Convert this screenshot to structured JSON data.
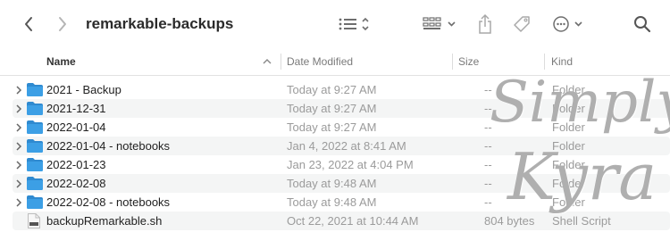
{
  "window": {
    "title": "remarkable-backups",
    "toolbar_icons": [
      "chevron-left-icon",
      "chevron-right-icon",
      "list-view-icon",
      "group-icon",
      "share-icon",
      "tag-icon",
      "more-icon",
      "search-icon"
    ]
  },
  "columns": {
    "name": "Name",
    "date_modified": "Date Modified",
    "size": "Size",
    "kind": "Kind"
  },
  "files": [
    {
      "name": "2021 - Backup",
      "date": "Today at 9:27 AM",
      "size": "--",
      "kind": "Folder",
      "type": "folder"
    },
    {
      "name": "2021-12-31",
      "date": "Today at 9:27 AM",
      "size": "--",
      "kind": "Folder",
      "type": "folder"
    },
    {
      "name": "2022-01-04",
      "date": "Today at 9:27 AM",
      "size": "--",
      "kind": "Folder",
      "type": "folder"
    },
    {
      "name": "2022-01-04 - notebooks",
      "date": "Jan 4, 2022 at 8:41 AM",
      "size": "--",
      "kind": "Folder",
      "type": "folder"
    },
    {
      "name": "2022-01-23",
      "date": "Jan 23, 2022 at 4:04 PM",
      "size": "--",
      "kind": "Folder",
      "type": "folder"
    },
    {
      "name": "2022-02-08",
      "date": "Today at 9:48 AM",
      "size": "--",
      "kind": "Folder",
      "type": "folder"
    },
    {
      "name": "2022-02-08 - notebooks",
      "date": "Today at 9:48 AM",
      "size": "--",
      "kind": "Folder",
      "type": "folder"
    },
    {
      "name": "backupRemarkable.sh",
      "date": "Oct 22, 2021 at 10:44 AM",
      "size": "804 bytes",
      "kind": "Shell Script",
      "type": "script"
    }
  ],
  "watermark": {
    "line1": "Simply",
    "line2": "Kyra"
  },
  "colors": {
    "folder": "#3c9fe5",
    "folder_tab": "#2f8ad0",
    "row_alt": "#f4f5f5"
  }
}
